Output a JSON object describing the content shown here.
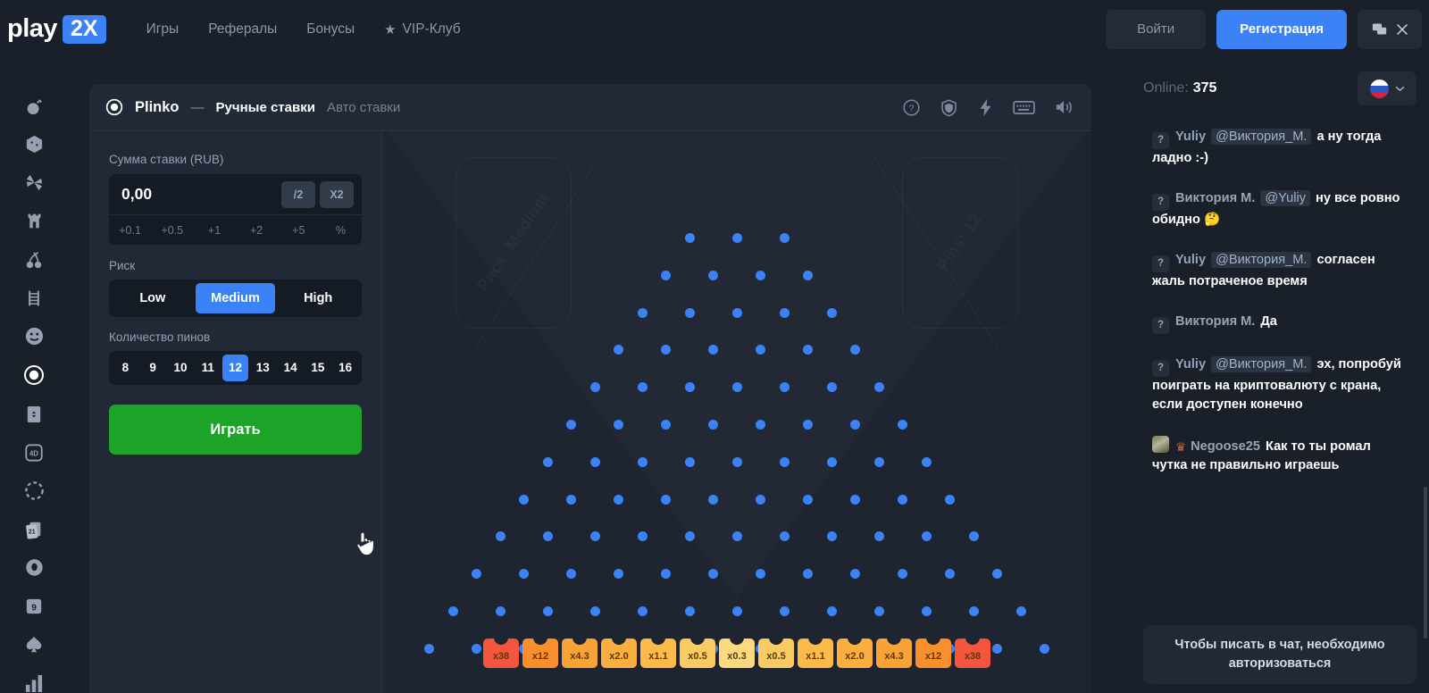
{
  "brand": {
    "name_main": "play",
    "name_badge": "2X"
  },
  "nav": {
    "items": [
      {
        "label": "Игры",
        "icon": null
      },
      {
        "label": "Рефералы",
        "icon": null
      },
      {
        "label": "Бонусы",
        "icon": null
      },
      {
        "label": "VIP-Клуб",
        "icon": "star-icon"
      }
    ]
  },
  "auth": {
    "login_label": "Войти",
    "register_label": "Регистрация"
  },
  "topbar_icons": [
    "chat-toggle-icon",
    "close-icon"
  ],
  "sidebar": {
    "items": [
      {
        "name": "bomb-icon",
        "glyph": "bomb"
      },
      {
        "name": "dice-icon",
        "glyph": "dice"
      },
      {
        "name": "pinwheel-icon",
        "glyph": "pinwheel"
      },
      {
        "name": "tower-icon",
        "glyph": "tower"
      },
      {
        "name": "cherry-icon",
        "glyph": "cherry"
      },
      {
        "name": "ladder-icon",
        "glyph": "ladder"
      },
      {
        "name": "smiley-icon",
        "glyph": "smiley"
      },
      {
        "name": "plinko-icon",
        "glyph": "plinko",
        "active": true
      },
      {
        "name": "card-icon",
        "glyph": "card"
      },
      {
        "name": "keno-icon",
        "glyph": "keno",
        "text": "4D"
      },
      {
        "name": "circle-dashed-icon",
        "glyph": "dashed"
      },
      {
        "name": "blackjack-icon",
        "glyph": "cards21",
        "text": "21"
      },
      {
        "name": "roulette-icon",
        "glyph": "roulette"
      },
      {
        "name": "nine-icon",
        "glyph": "nine",
        "text": "9"
      },
      {
        "name": "spade-icon",
        "glyph": "spade"
      },
      {
        "name": "bars-icon",
        "glyph": "bars"
      }
    ]
  },
  "game": {
    "title": "Plinko",
    "separator": "—",
    "tab_manual": "Ручные ставки",
    "tab_auto": "Авто ставки",
    "header_icons": [
      "help-icon",
      "shield-icon",
      "lightning-icon",
      "keyboard-icon",
      "sound-icon"
    ]
  },
  "bet": {
    "amount_label": "Сумма ставки (RUB)",
    "amount_value": "0,00",
    "half_label": "/2",
    "double_label": "X2",
    "quick_add": [
      "+0.1",
      "+0.5",
      "+1",
      "+2",
      "+5",
      "%"
    ],
    "risk_label": "Риск",
    "risk_options": [
      "Low",
      "Medium",
      "High"
    ],
    "risk_selected": "Medium",
    "pins_label": "Количество пинов",
    "pins_options": [
      "8",
      "9",
      "10",
      "11",
      "12",
      "13",
      "14",
      "15",
      "16"
    ],
    "pins_selected": "12",
    "play_label": "Играть"
  },
  "board": {
    "watermark_left": "Риск: Medium",
    "watermark_right": "Pins: 12",
    "pin_color": "#3b82f6",
    "pin_rows": [
      3,
      4,
      5,
      6,
      7,
      8,
      9,
      10,
      11,
      12,
      13,
      14
    ],
    "buckets": [
      {
        "label": "x38",
        "color": "#f4553d"
      },
      {
        "label": "x12",
        "color": "#f88f2c"
      },
      {
        "label": "x4.3",
        "color": "#f9a235"
      },
      {
        "label": "x2.0",
        "color": "#fbaf3e"
      },
      {
        "label": "x1.1",
        "color": "#fcbb49"
      },
      {
        "label": "x0.5",
        "color": "#fbcb63"
      },
      {
        "label": "x0.3",
        "color": "#fbd97e"
      },
      {
        "label": "x0.5",
        "color": "#fbcb63"
      },
      {
        "label": "x1.1",
        "color": "#fcbb49"
      },
      {
        "label": "x2.0",
        "color": "#fbaf3e"
      },
      {
        "label": "x4.3",
        "color": "#f9a235"
      },
      {
        "label": "x12",
        "color": "#f88f2c"
      },
      {
        "label": "x38",
        "color": "#f4553d"
      }
    ]
  },
  "chat": {
    "online_label": "Online:",
    "online_count": "375",
    "language": "ru",
    "messages": [
      {
        "avatar": "?",
        "avatar_type": "placeholder",
        "username": "Yuliy",
        "username_style": "y",
        "mention": "@Виктория_М.",
        "text": "а ну тогда ладно :-)"
      },
      {
        "avatar": "?",
        "avatar_type": "placeholder",
        "username": "Виктория М.",
        "username_style": "n",
        "mention": "@Yuliy",
        "text": "ну все ровно обидно 🤔"
      },
      {
        "avatar": "?",
        "avatar_type": "placeholder",
        "username": "Yuliy",
        "username_style": "y",
        "mention": "@Виктория_М.",
        "text": "согласен\nжаль потраченое время"
      },
      {
        "avatar": "?",
        "avatar_type": "placeholder",
        "username": "Виктория М.",
        "username_style": "n",
        "mention": "",
        "text": "Да"
      },
      {
        "avatar": "?",
        "avatar_type": "placeholder",
        "username": "Yuliy",
        "username_style": "y",
        "mention": "@Виктория_М.",
        "text": "эх, попробуй поиграть на криптовалюту с крана, если доступен конечно"
      },
      {
        "avatar": "",
        "avatar_type": "image",
        "badge": "crown-icon",
        "username": "Negoose25",
        "username_style": "n",
        "mention": "",
        "text": "Как то ты ромал чутка не правильно играешь"
      }
    ],
    "footer_notice": "Чтобы писать в чат, необходимо авторизоваться"
  },
  "colors": {
    "accent_blue": "#3b82f6",
    "play_green": "#1da328",
    "bg_dark": "#1a2029",
    "panel": "#212936",
    "board_bg": "#1e2530"
  }
}
